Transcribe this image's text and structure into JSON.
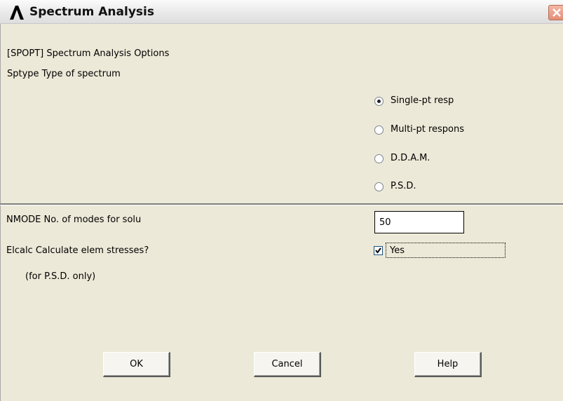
{
  "window": {
    "title": "Spectrum Analysis",
    "icon": "ansys-logo-icon",
    "close_icon": "close-icon"
  },
  "section_header": "[SPOPT]  Spectrum Analysis Options",
  "sptype": {
    "label": "Sptype  Type of spectrum",
    "options": [
      {
        "label": "Single-pt resp",
        "selected": true
      },
      {
        "label": "Multi-pt respons",
        "selected": false
      },
      {
        "label": "D.D.A.M.",
        "selected": false
      },
      {
        "label": "P.S.D.",
        "selected": false
      }
    ]
  },
  "nmode": {
    "label": "NMODE  No. of modes for solu",
    "value": "50"
  },
  "elcalc": {
    "label": "Elcalc  Calculate elem stresses?",
    "note": "(for P.S.D. only)",
    "checkbox_label": "Yes",
    "checked": true
  },
  "buttons": {
    "ok": "OK",
    "cancel": "Cancel",
    "help": "Help"
  },
  "colors": {
    "background": "#ece9d8",
    "close_button": "#e39077"
  }
}
